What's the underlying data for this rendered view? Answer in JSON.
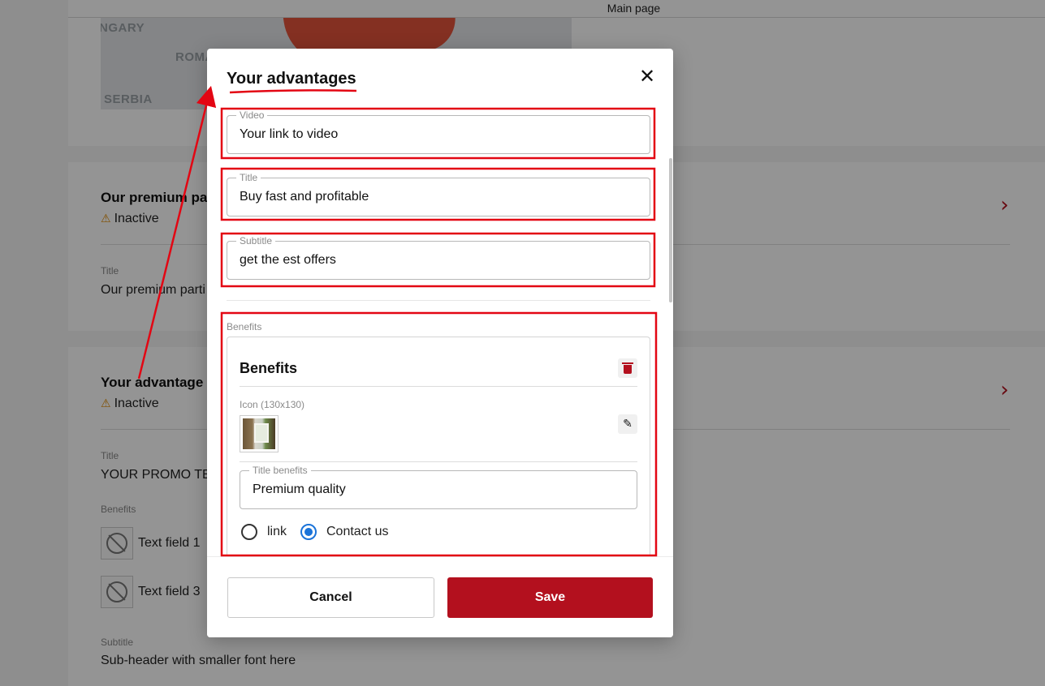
{
  "background": {
    "topbar_label": "Main page",
    "map_labels": [
      "NGARY",
      "ROMA",
      "SERBIA"
    ],
    "card_premium": {
      "heading": "Our premium pa",
      "status": "Inactive",
      "title_label": "Title",
      "title_value": "Our premium parti"
    },
    "card_advantages": {
      "heading": "Your advantage",
      "status": "Inactive",
      "title_label": "Title",
      "title_value": "YOUR PROMO TEX",
      "benefits_label": "Benefits",
      "benefits": [
        "Text field 1",
        "Text field 3"
      ],
      "subtitle_label": "Subtitle",
      "subtitle_value": "Sub-header with smaller font here"
    }
  },
  "modal": {
    "title": "Your advantages",
    "close_glyph": "✕",
    "video": {
      "label": "Video",
      "value": "Your link to video"
    },
    "title_field": {
      "label": "Title",
      "value": "Buy fast and profitable"
    },
    "subtitle": {
      "label": "Subtitle",
      "value": "get the est offers"
    },
    "benefits_section_label": "Benefits",
    "benefit_item": {
      "heading": "Benefits",
      "icon_label": "Icon (130x130)",
      "title_benefits": {
        "label": "Title benefits",
        "value": "Premium quality"
      },
      "radio_options": [
        {
          "label": "link",
          "checked": false
        },
        {
          "label": "Contact us",
          "checked": true
        }
      ]
    },
    "cancel_label": "Cancel",
    "save_label": "Save"
  },
  "colors": {
    "accent": "#b3101e",
    "annotation": "#e30613",
    "radio_selected": "#1a73d9"
  }
}
